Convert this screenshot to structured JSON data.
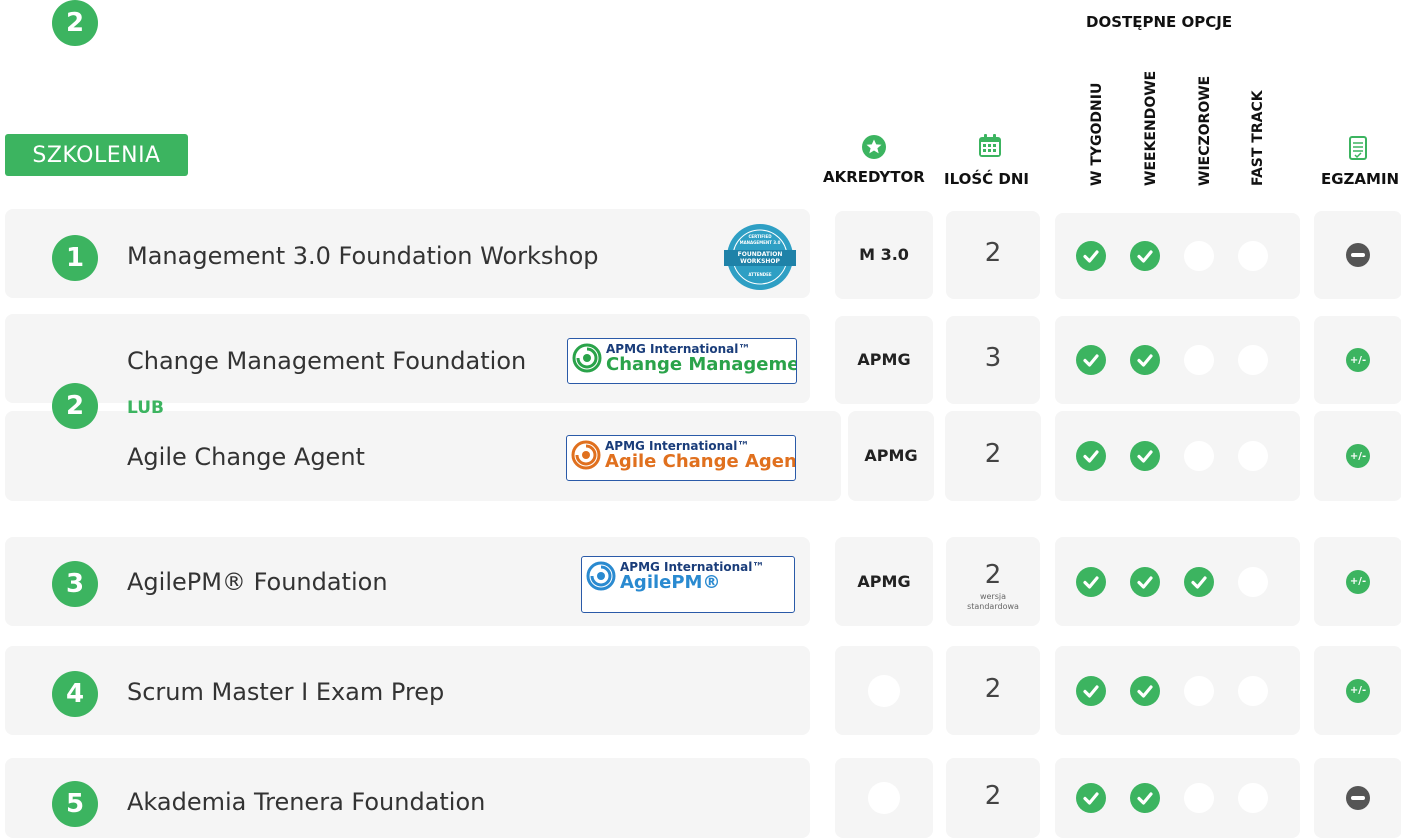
{
  "header": {
    "title": "SZKOLENIA",
    "options_group": "DOSTĘPNE OPCJE",
    "col_accreditor": "AKREDYTOR",
    "col_days": "ILOŚĆ DNI",
    "col_options": [
      "W TYGODNIU",
      "WEEKENDOWE",
      "WIECZOROWE",
      "FAST TRACK"
    ],
    "col_exam": "EGZAMIN",
    "icons": {
      "accreditor": "star-badge-icon",
      "days": "calendar-icon",
      "exam": "exam-sheet-icon"
    }
  },
  "colors": {
    "accent": "#3cb460",
    "panel": "#f5f5f5",
    "minus": "#555555"
  },
  "or_label": "LUB",
  "courses": [
    {
      "number": "1",
      "name": "Management 3.0 Foundation Workshop",
      "accreditor": "M 3.0",
      "days": "2",
      "logo": {
        "type": "seal",
        "lines": [
          "CERTIFIED",
          "MANAGEMENT 3.0",
          "FOUNDATION",
          "WORKSHOP",
          "ATTENDEE"
        ]
      },
      "options": [
        true,
        true,
        false,
        false
      ],
      "exam": "none"
    },
    {
      "number": "2",
      "name": "Change Management Foundation",
      "accreditor": "APMG",
      "days": "3",
      "logo": {
        "type": "apmg",
        "line1": "APMG International™",
        "line2": "Change Management",
        "color": "#2aa34a"
      },
      "options": [
        true,
        true,
        false,
        false
      ],
      "exam": "optional"
    },
    {
      "number": "",
      "name": "Agile Change Agent",
      "accreditor": "APMG",
      "days": "2",
      "logo": {
        "type": "apmg",
        "line1": "APMG International™",
        "line2": "Agile Change Agent",
        "color": "#e0701e"
      },
      "options": [
        true,
        true,
        false,
        false
      ],
      "exam": "optional"
    },
    {
      "number": "3",
      "name": "AgilePM® Foundation",
      "accreditor": "APMG",
      "days": "2",
      "days_note": "wersja standardowa",
      "logo": {
        "type": "apmg",
        "line1": "APMG International™",
        "line2": "AgilePM®",
        "color": "#2a8ad0"
      },
      "options": [
        true,
        true,
        true,
        false
      ],
      "exam": "optional"
    },
    {
      "number": "4",
      "name": "Scrum Master I Exam Prep",
      "accreditor": "",
      "days": "2",
      "options": [
        true,
        true,
        false,
        false
      ],
      "exam": "optional"
    },
    {
      "number": "5",
      "name": "Akademia Trenera Foundation",
      "accreditor": "",
      "days": "2",
      "options": [
        true,
        true,
        false,
        false
      ],
      "exam": "none"
    }
  ],
  "exam_symbols": {
    "optional": "+/-"
  }
}
